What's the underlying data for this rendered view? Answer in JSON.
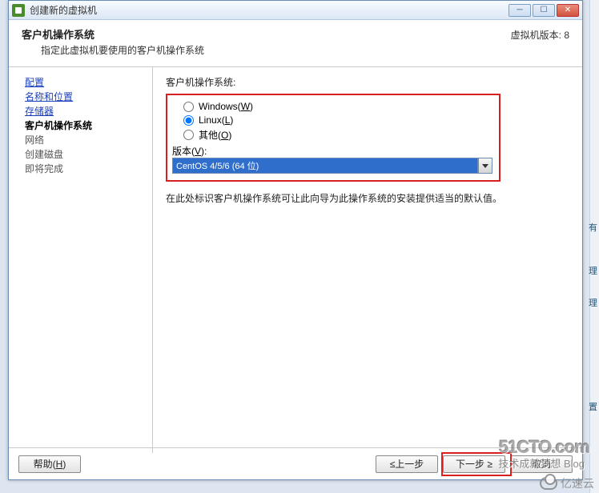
{
  "window": {
    "title": "创建新的虚拟机",
    "version_label": "虚拟机版本: 8"
  },
  "header": {
    "title": "客户机操作系统",
    "subtitle": "指定此虚拟机要使用的客户机操作系统"
  },
  "sidebar": {
    "items": [
      {
        "label": "配置",
        "type": "link"
      },
      {
        "label": "名称和位置",
        "type": "link"
      },
      {
        "label": "存储器",
        "type": "link"
      },
      {
        "label": "客户机操作系统",
        "type": "current"
      },
      {
        "label": "网络",
        "type": "plain"
      },
      {
        "label": "创建磁盘",
        "type": "plain"
      },
      {
        "label": "即将完成",
        "type": "plain"
      }
    ]
  },
  "content": {
    "os_label": "客户机操作系统:",
    "radios": {
      "windows": {
        "text": "Windows(",
        "shortcut": "W",
        "suffix": ")",
        "checked": false
      },
      "linux": {
        "text": "Linux(",
        "shortcut": "L",
        "suffix": ")",
        "checked": true
      },
      "other": {
        "text": "其他(",
        "shortcut": "O",
        "suffix": ")",
        "checked": false
      }
    },
    "version_prefix": "版本(",
    "version_shortcut": "V",
    "version_suffix": "):",
    "version_value": "CentOS 4/5/6 (64 位)",
    "hint": "在此处标识客户机操作系统可让此向导为此操作系统的安装提供适当的默认值。"
  },
  "footer": {
    "help_prefix": "帮助(",
    "help_shortcut": "H",
    "help_suffix": ")",
    "back": "≤上一步",
    "next": "下一步 ≥",
    "cancel": "取消"
  },
  "watermarks": {
    "w1": "51CTO.com",
    "w2": "技术成就梦想 Blog",
    "w3": "亿速云"
  },
  "strip": {
    "c1": "有",
    "c2": "理",
    "c3": "理",
    "c4": "置"
  }
}
